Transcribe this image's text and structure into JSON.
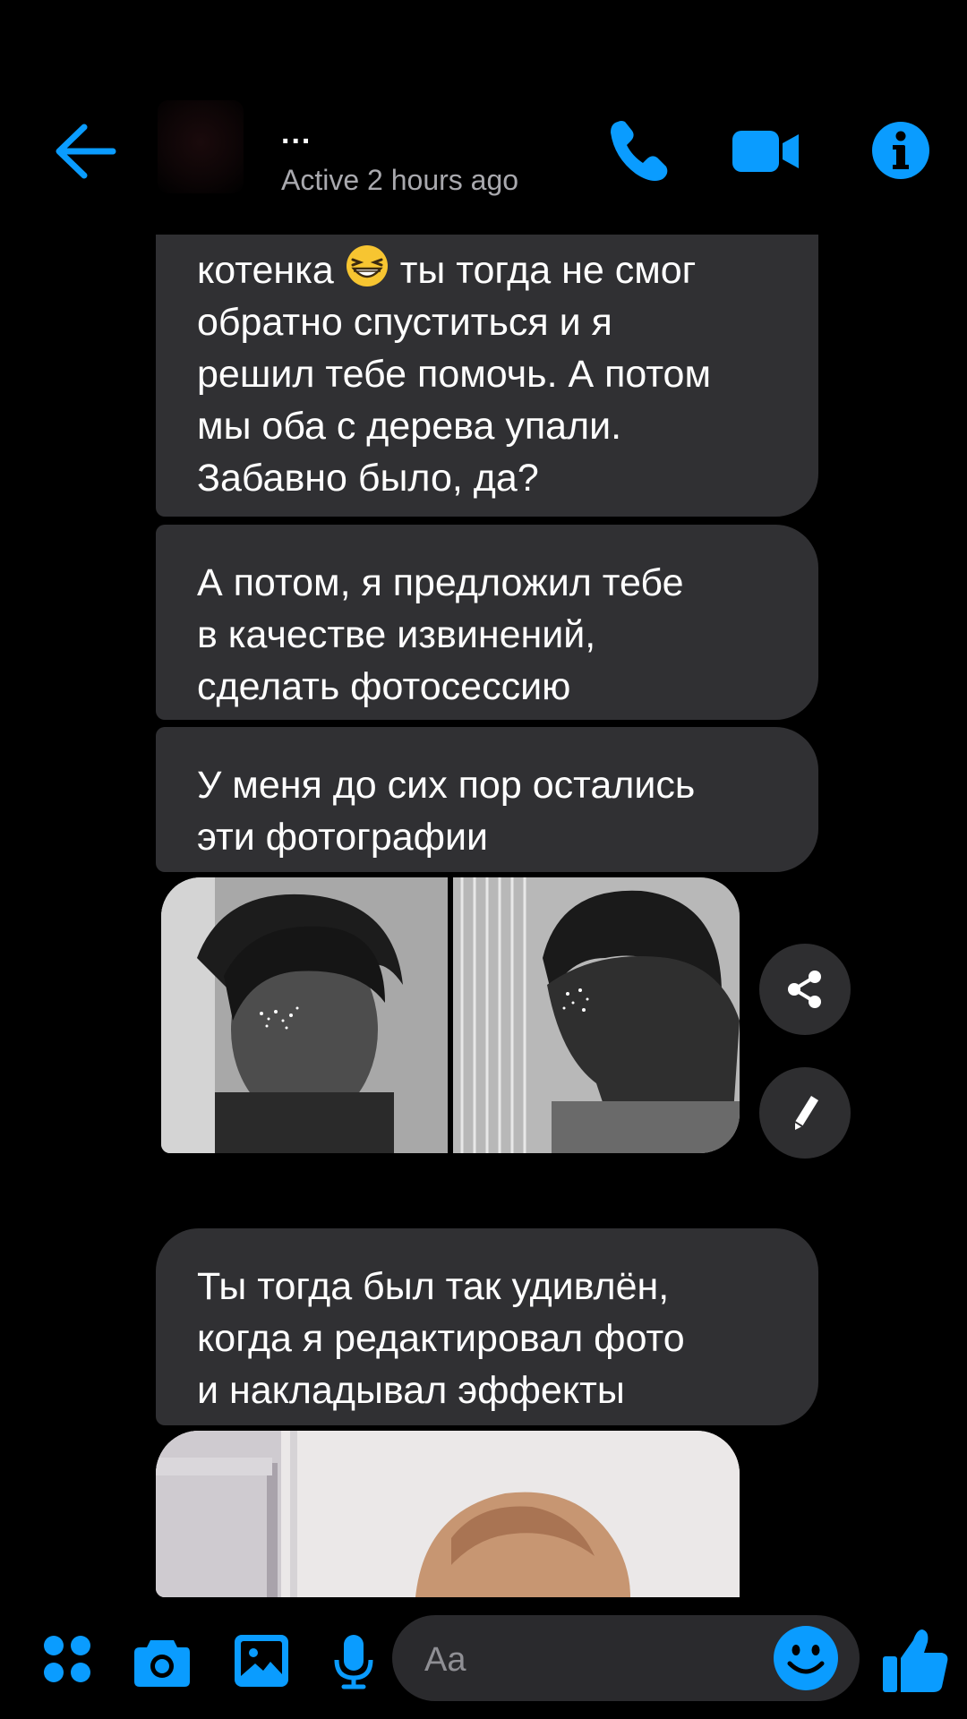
{
  "header": {
    "contact_name": "...",
    "status": "Active 2 hours ago",
    "icons": {
      "back": "arrow-left-icon",
      "call": "phone-icon",
      "video": "video-camera-icon",
      "info": "info-icon"
    }
  },
  "messages": [
    {
      "lines": [
        "ты тогда не смог",
        "обратно спуститься и я",
        "решил тебе помочь. А потом",
        "мы оба с дерева упали.",
        "Забавно было, да?"
      ],
      "first_line_prefix": "котенка"
    },
    {
      "lines": [
        "А потом, я предложил тебе",
        "в качестве извинений,",
        "сделать фотосессию"
      ]
    },
    {
      "lines": [
        "У меня до сих пор остались",
        "эти фотографии"
      ]
    },
    {
      "lines": [
        "Ты тогда был так удивлён,",
        "когда я редактировал фото",
        "и накладывал эффекты"
      ]
    }
  ],
  "photo_actions": {
    "share_icon": "share-icon",
    "edit_icon": "pencil-icon"
  },
  "composer": {
    "placeholder": "Aa",
    "icons": {
      "apps": "apps-grid-icon",
      "camera": "camera-icon",
      "gallery": "image-icon",
      "mic": "microphone-icon",
      "emoji": "smiley-icon",
      "like": "thumbs-up-icon"
    }
  },
  "colors": {
    "accent": "#0a9cff",
    "bubble": "#303033",
    "background": "#000000",
    "status_text": "#a9a9ae"
  }
}
